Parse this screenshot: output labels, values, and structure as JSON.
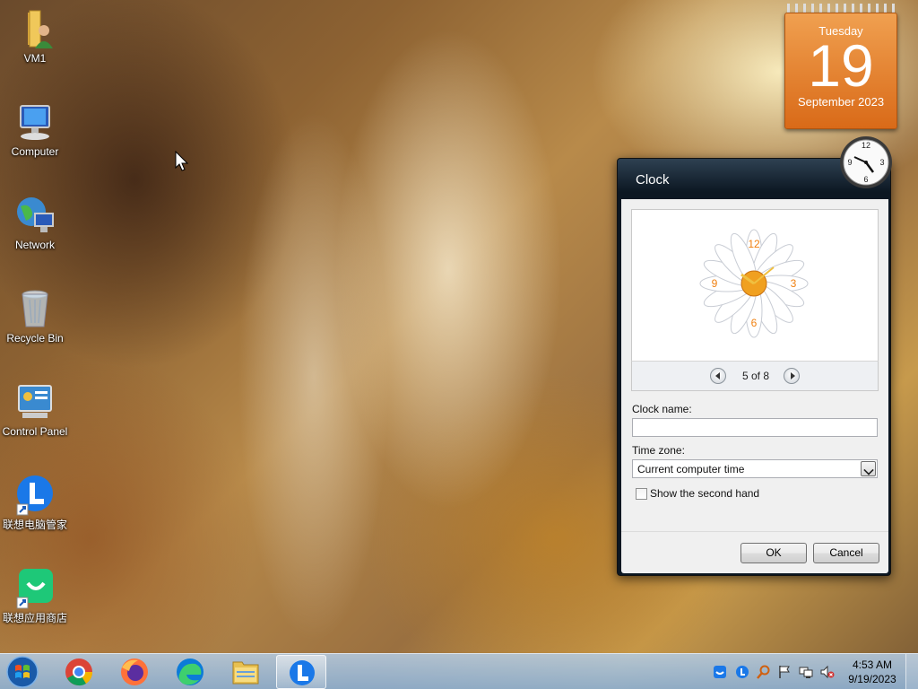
{
  "desktop": {
    "icons": [
      {
        "label": "VM1",
        "icon": "user-folder-icon"
      },
      {
        "label": "Computer",
        "icon": "computer-icon"
      },
      {
        "label": "Network",
        "icon": "network-icon"
      },
      {
        "label": "Recycle Bin",
        "icon": "recycle-bin-icon"
      },
      {
        "label": "Control Panel",
        "icon": "control-panel-icon"
      },
      {
        "label": "联想电脑管家",
        "icon": "lenovo-manager-icon"
      },
      {
        "label": "联想应用商店",
        "icon": "lenovo-app-store-icon"
      }
    ]
  },
  "calendar": {
    "weekday": "Tuesday",
    "day": "19",
    "month_year": "September 2023"
  },
  "dialog": {
    "title": "Clock",
    "nav_count": "5 of 8",
    "clock_name_label": "Clock name:",
    "clock_name_value": "",
    "time_zone_label": "Time zone:",
    "time_zone_value": "Current computer time",
    "second_hand_label": "Show the second hand",
    "second_hand_checked": false,
    "ok_label": "OK",
    "cancel_label": "Cancel"
  },
  "taskbar": {
    "apps": [
      "start-orb-icon",
      "chrome-icon",
      "firefox-icon",
      "edge-icon",
      "file-explorer-icon",
      "lenovo-manager-icon"
    ],
    "tray": [
      "lenovo-tray-icon",
      "lenovo-l-icon",
      "search-tray-icon",
      "flag-icon",
      "network-tray-icon",
      "volume-muted-icon"
    ],
    "time": "4:53 AM",
    "date": "9/19/2023"
  },
  "colors": {
    "calendar_orange": "#e07828",
    "taskbar_blue": "#a8c4e0",
    "dialog_header": "#0c1722"
  }
}
